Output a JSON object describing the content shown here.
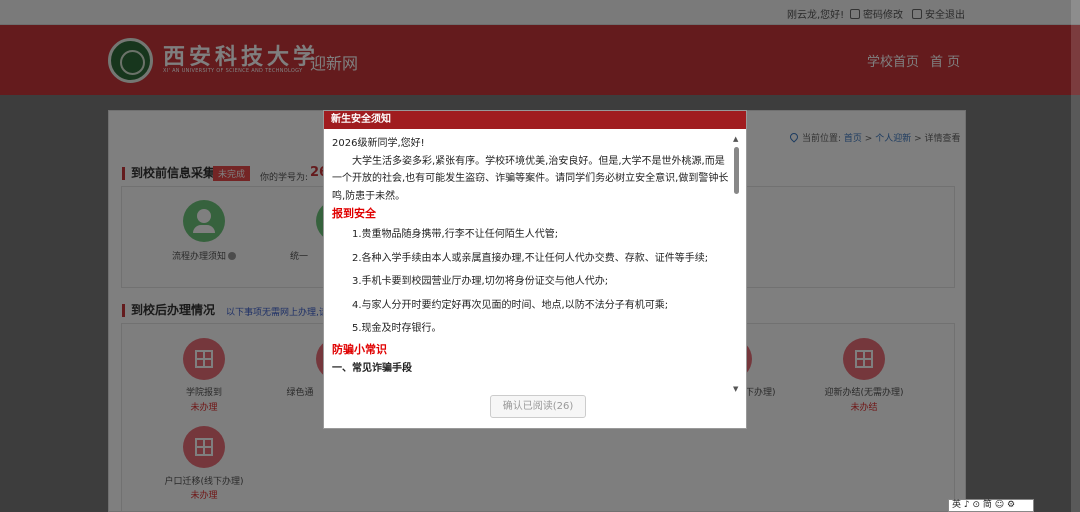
{
  "topbar": {
    "greeting": "刚云龙,您好!",
    "change_password": "密码修改",
    "logout": "安全退出"
  },
  "header": {
    "brand_cn": "西安科技大学",
    "brand_en": "XI' AN UNIVERSITY OF SCIENCE AND TECHNOLOGY",
    "subtitle": "迎新网",
    "nav": [
      "学校首页",
      "首 页"
    ]
  },
  "breadcrumb": {
    "prefix": "当前位置:",
    "home": "首页",
    "sep": " > ",
    "section": "个人迎新",
    "current": "详情查看"
  },
  "pre_arrival": {
    "title": "到校前信息采集",
    "status": "未完成",
    "id_label": "你的学号为:",
    "id_value": "26",
    "items": [
      {
        "label": "流程办理须知"
      },
      {
        "label": "统一"
      }
    ]
  },
  "post_arrival": {
    "title": "到校后办理情况",
    "note": "以下事项无需网上办理,请",
    "items": [
      {
        "label": "学院报到",
        "status": "未办理"
      },
      {
        "label": "绿色通",
        "status": ""
      },
      {
        "label": "下办理)",
        "status": ""
      },
      {
        "label": "迎新办结(无需办理)",
        "status": "未办结"
      },
      {
        "label": "户口迁移(线下办理)",
        "status": "未办理"
      }
    ]
  },
  "modal": {
    "title": "新生安全须知",
    "greeting": "2026级新同学,您好!",
    "intro": "大学生活多姿多彩,紧张有序。学校环境优美,治安良好。但是,大学不是世外桃源,而是一个开放的社会,也有可能发生盗窃、诈骗等案件。请同学们务必树立安全意识,做到警钟长鸣,防患于未然。",
    "section1": "报到安全",
    "rules": [
      "1.贵重物品随身携带,行李不让任何陌生人代管;",
      "2.各种入学手续由本人或亲属直接办理,不让任何人代办交费、存款、证件等手续;",
      "3.手机卡要到校园营业厅办理,切勿将身份证交与他人代办;",
      "4.与家人分开时要约定好再次见面的时间、地点,以防不法分子有机可乘;",
      "5.现金及时存银行。"
    ],
    "section2": "防骗小常识",
    "subsection": "一、常见诈骗手段",
    "button": "确认已阅读(26)"
  },
  "ime": "英 ♪ ⊙ 简 ☺ ⚙"
}
